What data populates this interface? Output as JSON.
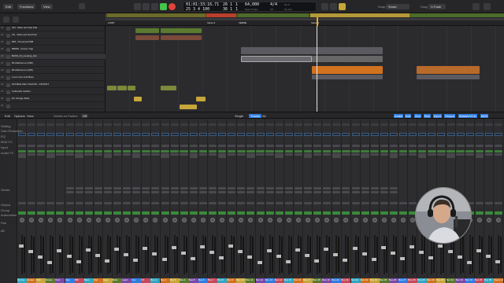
{
  "control_bar": {
    "edit_label": "Edit",
    "functions_label": "Functions",
    "view_label": "View",
    "lcd": {
      "time": "01:01:33:16.71",
      "bars": "25 3 4 100",
      "pos_top": "26 1",
      "pos_bot": "36 1",
      "pos_top2": "1",
      "pos_bot2": "1",
      "tempo": "64,000",
      "tempo_label": "Keep Tempo",
      "signature": "4/4",
      "signature_sub": "/16",
      "no_in": "No In",
      "no_out": "No Out"
    },
    "snap_label": "Snap",
    "snap_value": "Smart",
    "drag_label": "Drag",
    "drag_value": "X-Fade"
  },
  "tracks": [
    {
      "num": "22",
      "name": "AM - Wide and Sad Pad"
    },
    {
      "num": "23",
      "name": "AS - Wide and Sad Pad"
    },
    {
      "num": "24",
      "name": "808 - Pressured 808"
    },
    {
      "num": "25",
      "name": "BB005 - Future Trap"
    },
    {
      "num": "26",
      "name": "BASS_01_meeting_skit"
    },
    {
      "num": "27",
      "name": "Bit Melbourne (OMI)"
    },
    {
      "num": "28",
      "name": "Bit Melbourne (OMI)"
    },
    {
      "num": "29",
      "name": "Lost in the Grid Bass"
    },
    {
      "num": "30",
      "name": "DOUBLE FELT GRAND - DISTANT"
    },
    {
      "num": "31",
      "name": "Cathedral Carillon"
    },
    {
      "num": "32",
      "name": "EV Vintage Bells"
    },
    {
      "num": "33",
      "name": ""
    }
  ],
  "ruler_labels": [
    "LOOP",
    "Verse 3",
    "VERSE",
    "Verse 2"
  ],
  "mixer_bar": {
    "edit_label": "Edit",
    "options_label": "Options",
    "view_label": "View",
    "sends_label": "Sends on Faders",
    "off_label": "Off",
    "single_label": "Single",
    "tracks_label": "Tracks",
    "all_label": "All",
    "filters": [
      "Audio",
      "Inst",
      "Aux",
      "Bus",
      "Input",
      "Output",
      "Master/VCA",
      "MIDI"
    ]
  },
  "mixer_row_labels": [
    "Setting",
    "Gain Reduction",
    "EQ",
    "MIDI FX",
    "Input",
    "Audio FX",
    "Sends",
    "Output",
    "Group",
    "Automation",
    "Pan",
    "dB"
  ],
  "mixer_channels": [
    "Drums",
    "Hi-Hat",
    "Kick",
    "Snare",
    "Perc",
    "Clap",
    "808",
    "Bass",
    "Pad",
    "Keys",
    "Bells",
    "Lead",
    "Vox",
    "FX",
    "Bus 1",
    "Bus 2",
    "Bus 3",
    "Bus 4",
    "Bus 5",
    "Bus 6",
    "Bus 7",
    "Bus 8",
    "Bus 9",
    "Bus 10",
    "Bus 11",
    "Bus 12",
    "Bus 13",
    "Bus 14",
    "Bus 15",
    "Bus 16",
    "Bus 17",
    "Bus 18",
    "Bus 19",
    "Bus 20",
    "Bus 21",
    "Bus 22",
    "Bus 23",
    "Bus 24",
    "Bus 25",
    "Bus 26",
    "Bus 27",
    "Bus 28",
    "Bus 29",
    "Bus 30",
    "Bus 31",
    "Bus 32",
    "Bus 33",
    "Bus 34",
    "Bus 35",
    "Bus 36",
    "Stereo Out"
  ],
  "colors": {
    "accent_blue": "#2f7de1",
    "region_green": "#5b7a2f",
    "region_orange": "#d1721e",
    "region_gray": "#5a5a60",
    "region_yellow": "#c7a63a",
    "play_green": "#45c24a",
    "record_red": "#e0443a"
  }
}
